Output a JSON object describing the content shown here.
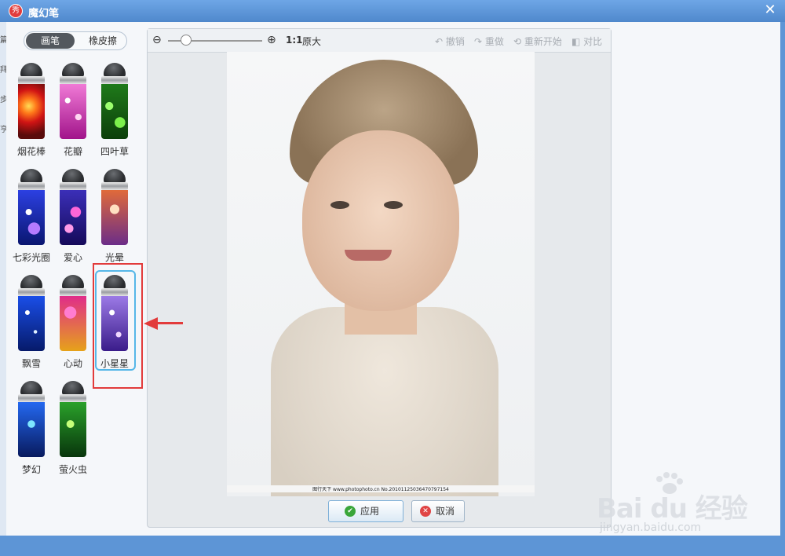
{
  "window": {
    "title": "魔幻笔",
    "app_icon_glyph": "秀",
    "close_glyph": "✕"
  },
  "left_edge_chars": [
    "篇",
    "拜",
    "步",
    "亨"
  ],
  "tabs": {
    "brush": "画笔",
    "eraser": "橡皮擦"
  },
  "brushes": [
    {
      "label": "烟花棒"
    },
    {
      "label": "花瓣"
    },
    {
      "label": "四叶草"
    },
    {
      "label": "七彩光圈"
    },
    {
      "label": "爱心"
    },
    {
      "label": "光晕"
    },
    {
      "label": "飘雪"
    },
    {
      "label": "心动"
    },
    {
      "label": "小星星"
    },
    {
      "label": "梦幻"
    },
    {
      "label": "萤火虫"
    }
  ],
  "selected_brush": "小星星",
  "toolbar": {
    "zoom_out_glyph": "⊖",
    "zoom_in_glyph": "⊕",
    "ratio": "1:1",
    "original": "原大",
    "undo": "撤销",
    "redo": "重做",
    "reset": "重新开始",
    "compare": "对比"
  },
  "photo_caption": "图行天下 www.photophoto.cn  No.20101125036470797154",
  "buttons": {
    "apply": "应用",
    "cancel": "取消",
    "ok_glyph": "✔",
    "x_glyph": "✕"
  },
  "watermark": {
    "main": "Bai du 经验",
    "sub": "jingyan.baidu.com"
  },
  "colors": {
    "title_bar": "#5d95d6",
    "selection": "#56b7e8",
    "annotation": "#e23b3b"
  }
}
